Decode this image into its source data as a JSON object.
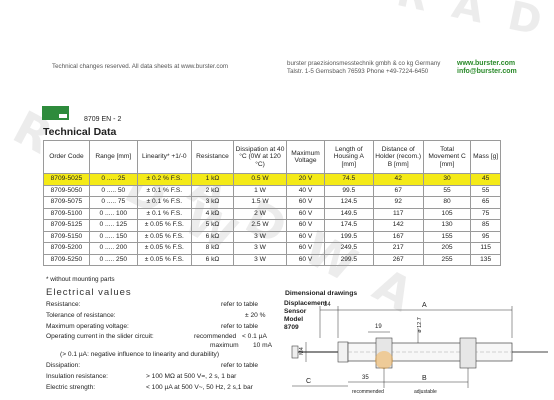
{
  "watermark": {
    "top_text": "R A D W",
    "diag_text_1": "R A D W",
    "diag_text_2": "R A D W A"
  },
  "header": {
    "left_note": "Technical changes reserved. All data sheets at www.burster.com",
    "company_line1": "burster praezisionsmesstechnik gmbh & co kg Germany",
    "company_line2": "Talstr. 1-5  Gernsbach 76593  Phone +49-7224-6450",
    "web": "www.burster.com",
    "email": "info@burster.com"
  },
  "doc_ref": "8709 EN - 2",
  "section_title": "Technical Data",
  "table": {
    "headers": [
      "Order Code",
      "Range [mm]",
      "Linearity* +1/-0",
      "Resistance",
      "Dissipation at 40 °C (0W at 120 °C)",
      "Maximum Voltage",
      "Length of Housing A [mm]",
      "Distance of Holder (recom.) B [mm]",
      "Total Movement C [mm]",
      "Mass [g]"
    ],
    "rows": [
      [
        "8709-5025",
        "0 .....   25",
        "± 0.2   % F.S.",
        "1 kΩ",
        "0.5  W",
        "20 V",
        "74.5",
        "42",
        "30",
        "45"
      ],
      [
        "8709-5050",
        "0 .....   50",
        "± 0.1   % F.S.",
        "2 kΩ",
        "1    W",
        "40 V",
        "99.5",
        "67",
        "55",
        "55"
      ],
      [
        "8709-5075",
        "0 .....   75",
        "± 0.1   % F.S.",
        "3 kΩ",
        "1.5  W",
        "60 V",
        "124.5",
        "92",
        "80",
        "65"
      ],
      [
        "8709-5100",
        "0 .....  100",
        "± 0.1   % F.S.",
        "4 kΩ",
        "2    W",
        "60 V",
        "149.5",
        "117",
        "105",
        "75"
      ],
      [
        "8709-5125",
        "0 .....  125",
        "± 0.05 % F.S.",
        "5 kΩ",
        "2.5  W",
        "60 V",
        "174.5",
        "142",
        "130",
        "85"
      ],
      [
        "8709-5150",
        "0 .....  150",
        "± 0.05 % F.S.",
        "6 kΩ",
        "3    W",
        "60 V",
        "199.5",
        "167",
        "155",
        "95"
      ],
      [
        "8709-5200",
        "0 .....  200",
        "± 0.05 % F.S.",
        "8 kΩ",
        "3    W",
        "60 V",
        "249.5",
        "217",
        "205",
        "115"
      ],
      [
        "8709-5250",
        "0 .....  250",
        "± 0.05 % F.S.",
        "6 kΩ",
        "3    W",
        "60 V",
        "299.5",
        "267",
        "255",
        "135"
      ]
    ]
  },
  "footnote": "* without mounting parts",
  "electrical": {
    "title": "Electrical values",
    "resistance_label": "Resistance:",
    "resistance_value": "refer to table",
    "tolerance_label": "Tolerance of resistance:",
    "tolerance_value": "± 20 %",
    "maxvolt_label": "Maximum operating voltage:",
    "maxvolt_value": "refer to table",
    "current_label": "Operating current in the slider circuit:",
    "current_rec_label": "recommended",
    "current_rec_value": "< 0.1 µA",
    "current_max_label": "maximum",
    "current_max_value": "10 mA",
    "current_note": "(> 0.1 µA: negative influence to linearity and durability)",
    "dissipation_label": "Dissipation:",
    "dissipation_value": "refer to table",
    "insulation_label": "Insulation resistance:",
    "insulation_value": "> 100 MΩ at 500 V=, 2 s, 1 bar",
    "strength_label": "Electric strength:",
    "strength_value": "< 100 µA at 500 V~, 50 Hz, 2 s,1 bar"
  },
  "drawings": {
    "title": "Dimensional drawings",
    "label_line1": "Displacement",
    "label_line2": "Sensor",
    "label_line3": "Model",
    "label_line4": "8709",
    "dim_24": "24",
    "dim_A": "A",
    "dim_19": "19",
    "dim_phi": "ø 12.7",
    "dim_M4": "M4",
    "dim_C": "C",
    "dim_35": "35",
    "dim_B": "B",
    "recommended": "recommended",
    "adjustable": "adjustable"
  }
}
